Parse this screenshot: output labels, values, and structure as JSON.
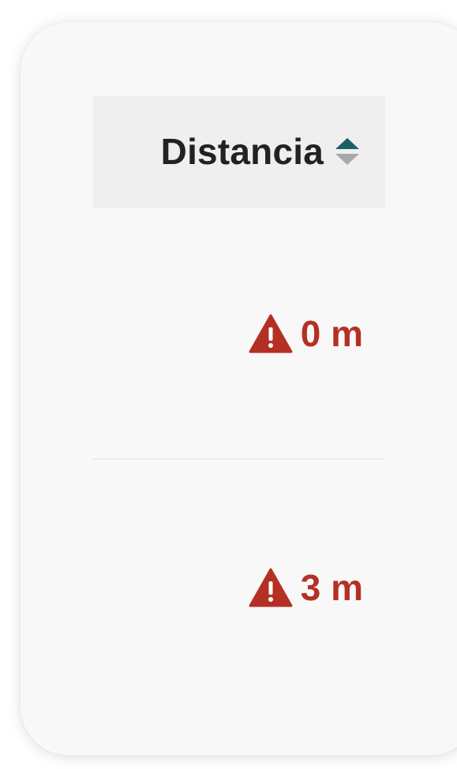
{
  "table": {
    "column_header": "Distancia",
    "sort_state": "ascending",
    "rows": [
      {
        "distance": "0 m",
        "status_icon": "warning-triangle-icon"
      },
      {
        "distance": "3 m",
        "status_icon": "warning-triangle-icon"
      }
    ]
  },
  "colors": {
    "card_background": "#f8f8f8",
    "header_background": "#efefef",
    "header_text": "#222222",
    "sort_active": "#1e5f66",
    "sort_inactive": "#a9a9a9",
    "warning": "#b53024"
  }
}
